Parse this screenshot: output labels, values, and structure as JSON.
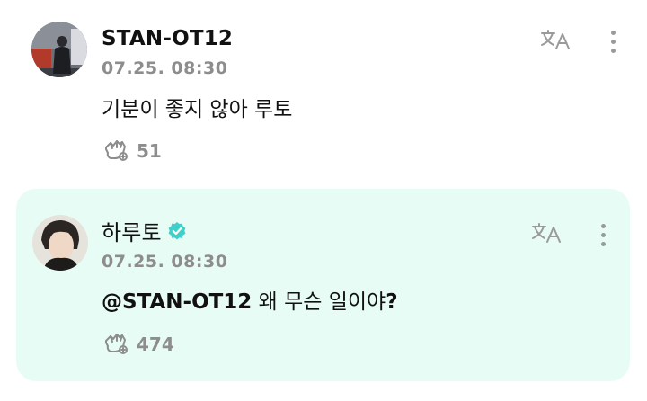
{
  "posts": [
    {
      "username": "STAN-OT12",
      "timestamp": "07.25. 08:30",
      "text": "기분이 좋지 않아 루토",
      "reaction_count": "51",
      "verified": false
    },
    {
      "username": "하루토",
      "timestamp": "07.25. 08:30",
      "mention": "@STAN-OT12",
      "text": " 왜 무슨 일이야",
      "text_end": "?",
      "reaction_count": "474",
      "verified": true
    }
  ],
  "icons": {
    "translate": "translate-icon",
    "more": "more-vertical-icon",
    "reaction": "reaction-hand-icon",
    "verified": "verified-badge-icon"
  },
  "colors": {
    "highlight_bg": "#e8fcf6",
    "verified": "#3fd0c9",
    "muted": "#8d8d8d"
  }
}
